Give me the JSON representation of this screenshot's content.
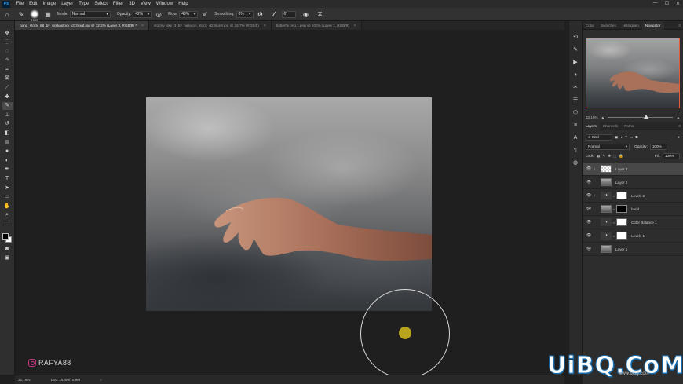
{
  "menubar": {
    "logo": "Ps",
    "items": [
      "File",
      "Edit",
      "Image",
      "Layer",
      "Type",
      "Select",
      "Filter",
      "3D",
      "View",
      "Window",
      "Help"
    ]
  },
  "options": {
    "brush_size": "1000",
    "mode_label": "Mode:",
    "mode_value": "Normal",
    "opacity_label": "Opacity:",
    "opacity_value": "42%",
    "flow_label": "Flow:",
    "flow_value": "49%",
    "smoothing_label": "Smoothing:",
    "smoothing_value": "0%",
    "angle_value": "0°"
  },
  "tabs": [
    {
      "label": "hand_stock_68_by_ssskastock_d13vxgf.jpg @ 32,2% (Layer 3, RGB/8) *",
      "active": true
    },
    {
      "label": "stormy_sky_3_by_pelleron_stock_d22sun6.jpg @ 16,7% (RGB/8)",
      "active": false
    },
    {
      "label": "butterfly png 1.png @ 100% (Layer 1, RGB/8)",
      "active": false
    }
  ],
  "canvas": {
    "watermark": "RAFYA88"
  },
  "status": {
    "zoom": "32,16%",
    "doc": "Doc: 15,4M/75,9M"
  },
  "panel": {
    "top_tabs": [
      "Color",
      "Swatches",
      "Histogram",
      "Navigator"
    ],
    "zoom": "32,16%",
    "zoom_fraction": 0.55,
    "layer_tabs": [
      "Layers",
      "Channels",
      "Paths"
    ],
    "kind_label": "Kind",
    "blend_mode": "Normal",
    "opacity_label": "Opacity:",
    "opacity_value": "100%",
    "lock_label": "Lock:",
    "fill_label": "Fill:",
    "fill_value": "100%",
    "layers": [
      {
        "name": "Layer 3",
        "thumb": "checker",
        "selected": true,
        "clip": true
      },
      {
        "name": "Layer 2",
        "thumb": "cloud",
        "selected": false,
        "clip": false
      },
      {
        "name": "Levels 2",
        "thumb": "adj",
        "mask": "white",
        "selected": false,
        "clip": true
      },
      {
        "name": "hand",
        "thumb": "cloud",
        "mask": "black",
        "selected": false,
        "clip": false
      },
      {
        "name": "Color Balance 1",
        "thumb": "adj",
        "mask": "white",
        "selected": false,
        "clip": false
      },
      {
        "name": "Levels 1",
        "thumb": "adj",
        "mask": "white",
        "selected": false,
        "clip": false
      },
      {
        "name": "Layer 1",
        "thumb": "cloud",
        "selected": false,
        "clip": false
      }
    ]
  },
  "branding": {
    "logo": "UiBQ.CoM",
    "url": "www.uibq.com"
  }
}
